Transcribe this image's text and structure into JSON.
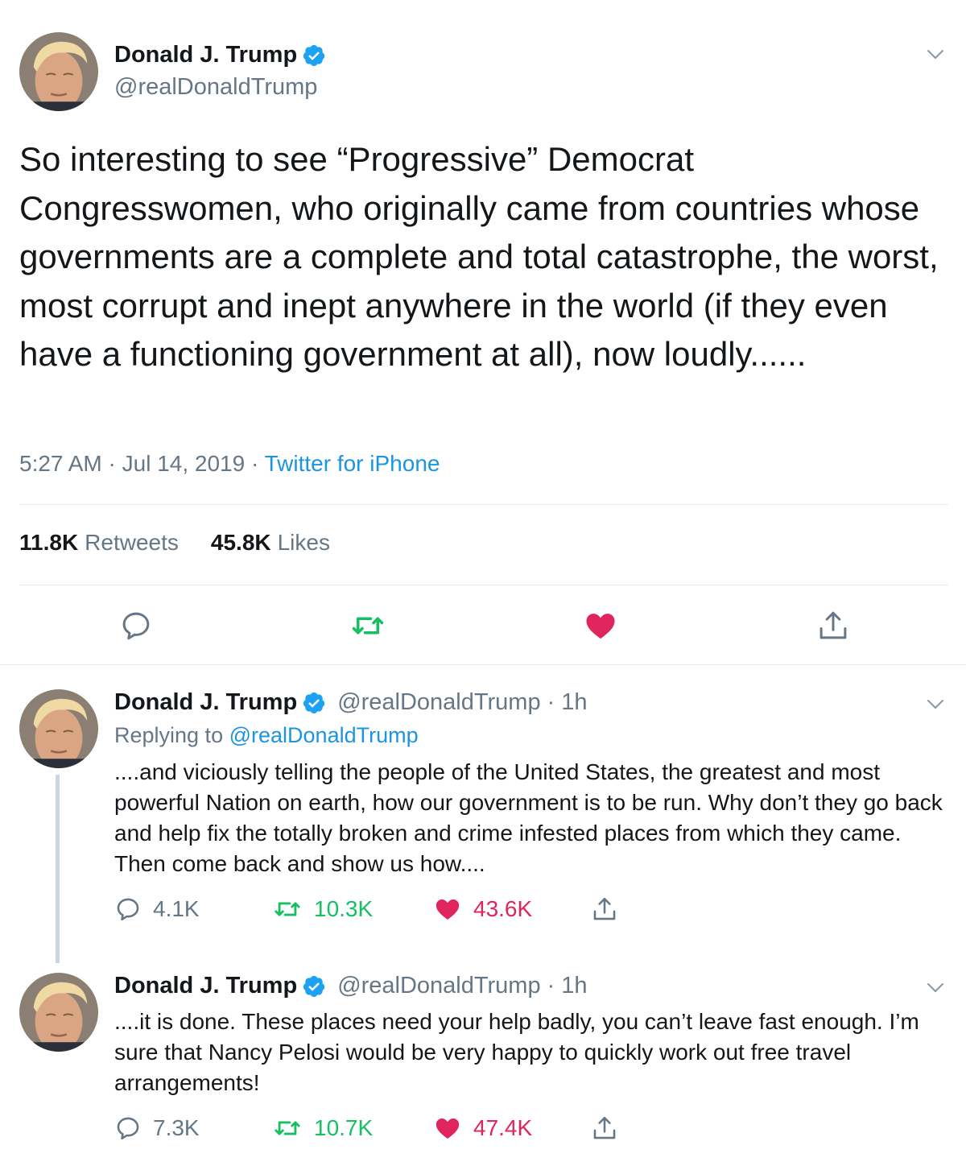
{
  "main_tweet": {
    "author_name": "Donald J. Trump",
    "handle": "@realDonaldTrump",
    "verified": true,
    "text": "So interesting to see “Progressive” Democrat Congresswomen, who originally came from countries whose governments are a complete and total catastrophe, the worst, most corrupt and inept anywhere in the world (if they even have a functioning government at all), now loudly......",
    "time": "5:27 AM",
    "date": "Jul 14, 2019",
    "separator": "·",
    "source": "Twitter for iPhone",
    "retweets_count": "11.8K",
    "retweets_label": "Retweets",
    "likes_count": "45.8K",
    "likes_label": "Likes",
    "liked": true,
    "retweeted": true
  },
  "replies": [
    {
      "author_name": "Donald J. Trump",
      "handle": "@realDonaldTrump",
      "separator": "·",
      "time": "1h",
      "replying_prefix": "Replying to",
      "replying_to": "@realDonaldTrump",
      "text": "....and viciously telling the people of the United States, the greatest and most powerful Nation on earth, how our government is to be run. Why don’t they go back and help fix the totally broken and crime infested places from which they came. Then come back and show us how....",
      "replies_count": "4.1K",
      "retweets_count": "10.3K",
      "likes_count": "43.6K"
    },
    {
      "author_name": "Donald J. Trump",
      "handle": "@realDonaldTrump",
      "separator": "·",
      "time": "1h",
      "text": "....it is done. These places need your help badly, you can’t leave fast enough. I’m sure that Nancy Pelosi would be very happy to quickly work out free travel arrangements!",
      "replies_count": "7.3K",
      "retweets_count": "10.7K",
      "likes_count": "47.4K"
    }
  ],
  "icons": [
    "avatar",
    "verified-badge-icon",
    "chevron-down-icon",
    "reply-icon",
    "retweet-icon",
    "heart-icon",
    "share-icon"
  ],
  "colors": {
    "text": "#14171a",
    "secondary": "#657786",
    "link": "#1b95e0",
    "verified": "#1da1f2",
    "retweet": "#17bf63",
    "like": "#e0245e",
    "border": "#e6ecf0",
    "thread_line": "#ccd6dd"
  }
}
